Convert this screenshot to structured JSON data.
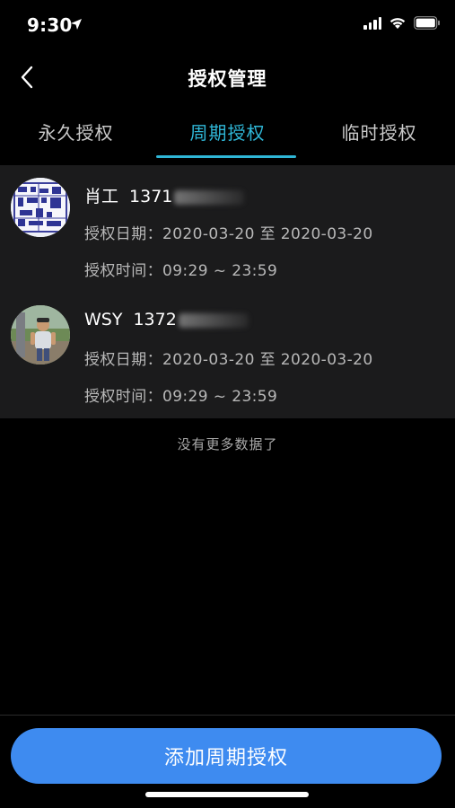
{
  "status_bar": {
    "time": "9:30"
  },
  "nav": {
    "title": "授权管理"
  },
  "tabs": [
    {
      "label": "永久授权",
      "active": false
    },
    {
      "label": "周期授权",
      "active": true
    },
    {
      "label": "临时授权",
      "active": false
    }
  ],
  "records": [
    {
      "name": "肖工",
      "phone_visible": "1371",
      "date_label": "授权日期：",
      "date_value": "2020-03-20 至 2020-03-20",
      "time_label": "授权时间：",
      "time_value": "09:29 ~ 23:59"
    },
    {
      "name": "WSY",
      "phone_visible": "1372",
      "date_label": "授权日期：",
      "date_value": "2020-03-20 至 2020-03-20",
      "time_label": "授权时间：",
      "time_value": "09:29 ~ 23:59"
    }
  ],
  "footer_note": "没有更多数据了",
  "add_button_label": "添加周期授权",
  "colors": {
    "accent": "#2fb6d6",
    "button": "#3e8bf0",
    "list_bg": "#1b1b1c"
  }
}
